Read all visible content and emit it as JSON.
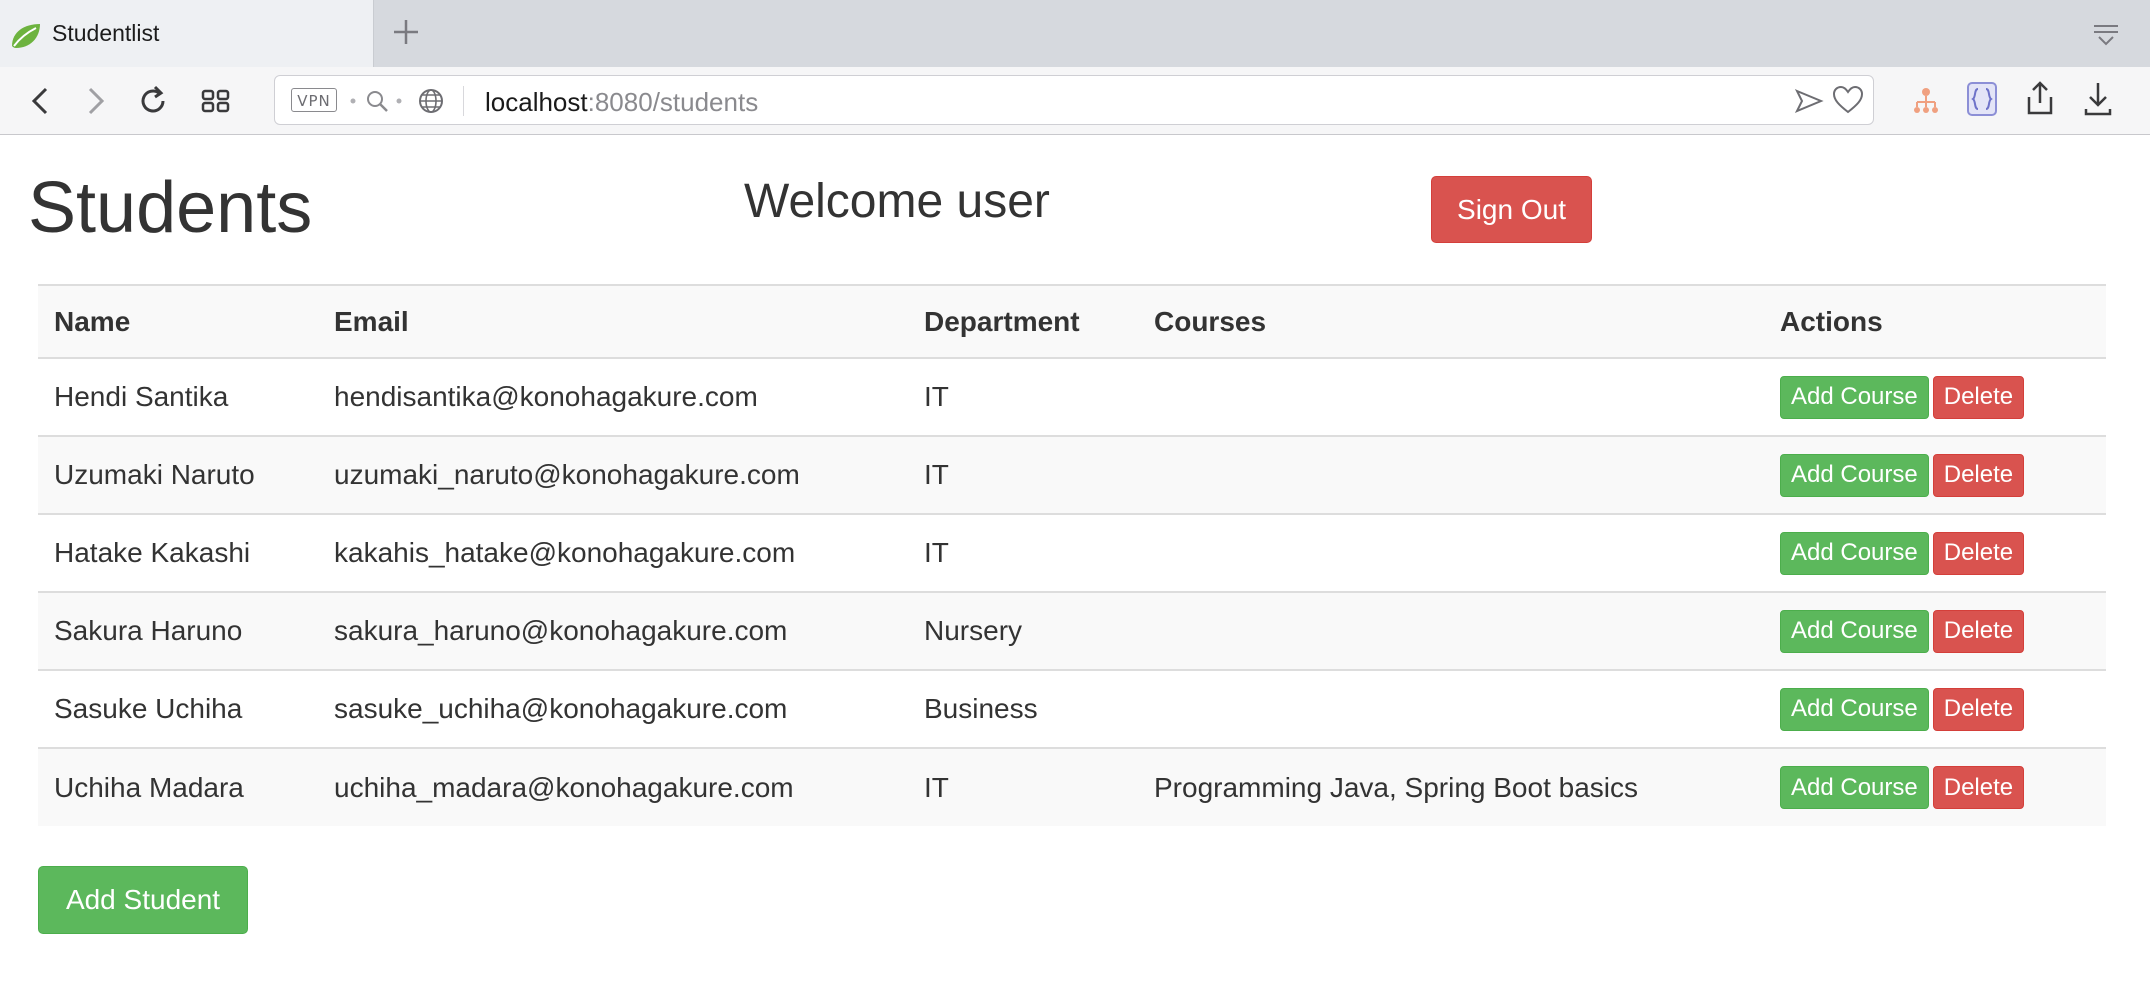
{
  "browser": {
    "tab_title": "Studentlist",
    "url_host": "localhost",
    "url_rest": ":8080/students",
    "vpn_label": "VPN"
  },
  "page": {
    "title": "Students",
    "welcome": "Welcome user",
    "sign_out_label": "Sign Out",
    "add_student_label": "Add Student"
  },
  "table": {
    "headers": {
      "name": "Name",
      "email": "Email",
      "department": "Department",
      "courses": "Courses",
      "actions": "Actions"
    },
    "rows": [
      {
        "name": "Hendi Santika",
        "email": "hendisantika@konohagakure.com",
        "department": "IT",
        "courses": "",
        "add_label": "Add Course",
        "delete_label": "Delete"
      },
      {
        "name": "Uzumaki Naruto",
        "email": "uzumaki_naruto@konohagakure.com",
        "department": "IT",
        "courses": "",
        "add_label": "Add Course",
        "delete_label": "Delete"
      },
      {
        "name": "Hatake Kakashi",
        "email": "kakahis_hatake@konohagakure.com",
        "department": "IT",
        "courses": "",
        "add_label": "Add Course",
        "delete_label": "Delete"
      },
      {
        "name": "Sakura Haruno",
        "email": "sakura_haruno@konohagakure.com",
        "department": "Nursery",
        "courses": "",
        "add_label": "Add Course",
        "delete_label": "Delete"
      },
      {
        "name": "Sasuke Uchiha",
        "email": "sasuke_uchiha@konohagakure.com",
        "department": "Business",
        "courses": "",
        "add_label": "Add Course",
        "delete_label": "Delete"
      },
      {
        "name": "Uchiha Madara",
        "email": "uchiha_madara@konohagakure.com",
        "department": "IT",
        "courses": "Programming Java, Spring Boot basics",
        "add_label": "Add Course",
        "delete_label": "Delete"
      }
    ]
  },
  "colors": {
    "success": "#5cb85c",
    "danger": "#d9534f",
    "text": "#333333"
  }
}
